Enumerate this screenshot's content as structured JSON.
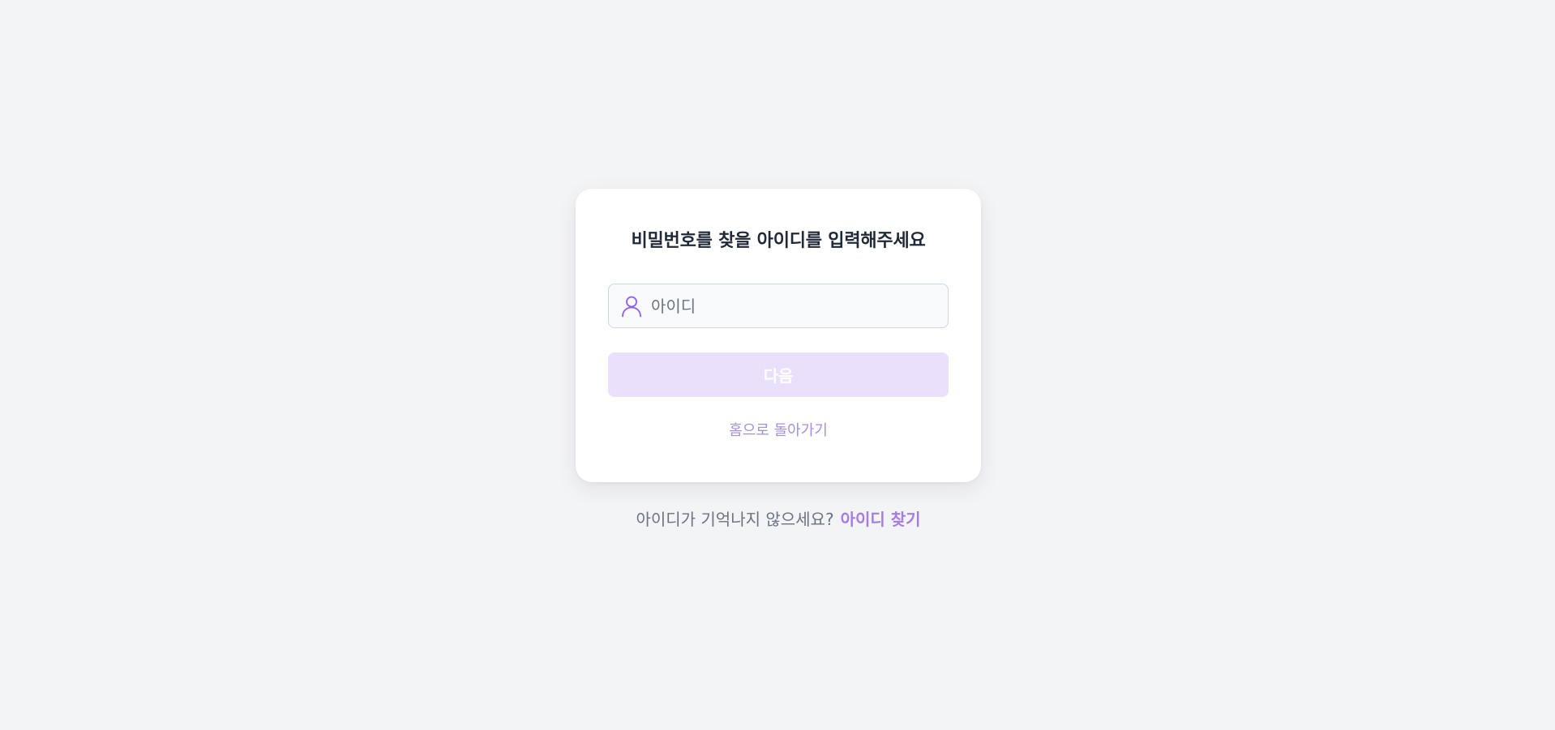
{
  "card": {
    "title": "비밀번호를 찾을 아이디를 입력해주세요",
    "id_input": {
      "value": "",
      "placeholder": "아이디",
      "icon": "user-icon"
    },
    "next_button_label": "다음",
    "home_link_label": "홈으로 돌아가기"
  },
  "footer": {
    "prompt_text": "아이디가 기억나지 않으세요?",
    "find_id_link_label": "아이디 찾기"
  },
  "colors": {
    "background": "#f3f4f6",
    "accent": "#a67ae8",
    "button_disabled": "#ebe0fb",
    "title_text": "#1f2937"
  }
}
